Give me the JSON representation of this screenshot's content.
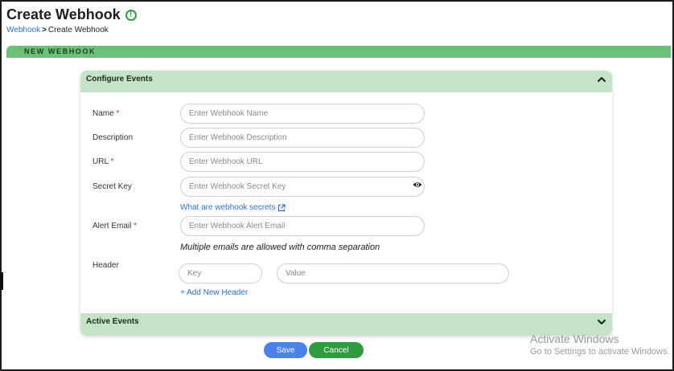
{
  "page": {
    "title": "Create Webhook",
    "breadcrumb": {
      "link": "Webhook",
      "separator": ">",
      "current": "Create Webhook"
    }
  },
  "section": {
    "title": "NEW WEBHOOK"
  },
  "configure_events": {
    "title": "Configure Events",
    "fields": {
      "name": {
        "label": "Name",
        "required": "*",
        "placeholder": "Enter Webhook Name"
      },
      "description": {
        "label": "Description",
        "placeholder": "Enter Webhook Description"
      },
      "url": {
        "label": "URL",
        "required": "*",
        "placeholder": "Enter Webhook URL"
      },
      "secret_key": {
        "label": "Secret Key",
        "placeholder": "Enter Webhook Secret Key"
      },
      "alert_email": {
        "label": "Alert Email",
        "required": "*",
        "placeholder": "Enter Webhook Alert Email"
      },
      "header": {
        "label": "Header",
        "key_placeholder": "Key",
        "value_placeholder": "Value"
      }
    },
    "help_link": "What are webhook secrets",
    "email_hint": "Multiple emails are allowed with comma separation",
    "add_header": "+ Add New Header"
  },
  "active_events": {
    "title": "Active Events"
  },
  "actions": {
    "save": "Save",
    "cancel": "Cancel"
  },
  "watermark": {
    "title": "Activate Windows",
    "subtitle": "Go to Settings to activate Windows."
  },
  "colors": {
    "section_bar": "#6ac177",
    "panel_header": "#c4e3c7",
    "link": "#2d6fd6",
    "save": "#4a82e8",
    "cancel": "#2e9b40",
    "required": "#d32f2f"
  },
  "icons": [
    "info-icon",
    "chevron-up-icon",
    "chevron-down-icon",
    "eye-icon",
    "external-link-icon"
  ]
}
